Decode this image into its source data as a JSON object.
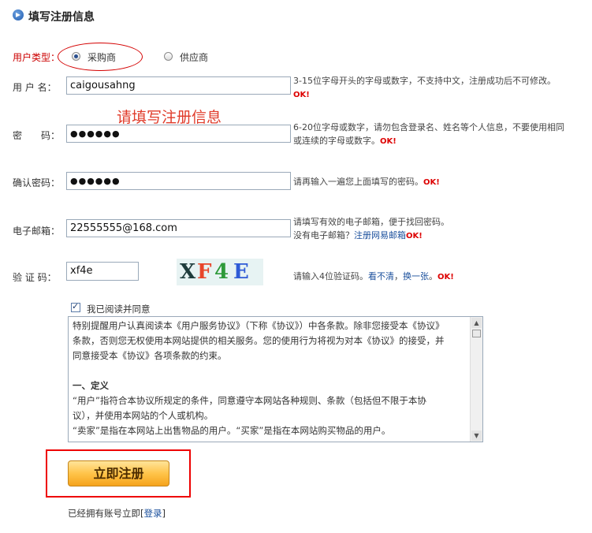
{
  "header": {
    "title": "填写注册信息"
  },
  "user_type": {
    "label": "用户类型：",
    "options": [
      "采购商",
      "供应商"
    ],
    "selected": "采购商"
  },
  "overlay_text": "请填写注册信息",
  "username": {
    "label": "用 户 名：",
    "value": "caigousahng",
    "hint": "3-15位字母开头的字母或数字，不支持中文，注册成功后不可修改。",
    "ok": "OK!"
  },
  "password": {
    "label": "密　　码：",
    "value": "●●●●●●",
    "hint_line1": "6-20位字母或数字，请勿包含登录名、姓名等个人信息，不要使用相同",
    "hint_line2": "或连续的字母或数字。",
    "ok": "OK!"
  },
  "confirm": {
    "label": "确认密码：",
    "value": "●●●●●●",
    "hint": "请再输入一遍您上面填写的密码。",
    "ok": "OK!"
  },
  "email": {
    "label": "电子邮箱：",
    "value": "22555555@168.com",
    "hint_line1": "请填写有效的电子邮箱，便于找回密码。",
    "hint_line2": "没有电子邮箱？",
    "link": "注册网易邮箱",
    "ok": "OK!"
  },
  "captcha": {
    "label": "验 证 码：",
    "value": "xf4e",
    "image_text": "XF4E",
    "hint_prefix": "请输入4位验证码。",
    "link1": "看不清",
    "sep": "，",
    "link2": "换一张",
    "suffix": "。",
    "ok": "OK!"
  },
  "agreement": {
    "checkbox_label": "我已阅读并同意",
    "checked": true,
    "paragraphs": [
      "特别提醒用户认真阅读本《用户服务协议》（下称《协议》）中各条款。除非您接受本《协议》",
      "条款，否则您无权使用本网站提供的相关服务。您的使用行为将视为对本《协议》的接受，并",
      "同意接受本《协议》各项条款的约束。",
      "",
      "一、定义",
      "“用户”指符合本协议所规定的条件，同意遵守本网站各种规则、条款（包括但不限于本协",
      "议），并使用本网站的个人或机构。",
      "“卖家”是指在本网站上出售物品的用户。“买家”是指在本网站购买物品的用户。"
    ]
  },
  "register_button": "立即注册",
  "login_prompt": {
    "text": "已经拥有账号立即[",
    "link": "登录",
    "close": "]"
  },
  "colors": {
    "accent_red": "#d40000",
    "link_blue": "#1a4f9c",
    "button_orange": "#ffc44a"
  }
}
